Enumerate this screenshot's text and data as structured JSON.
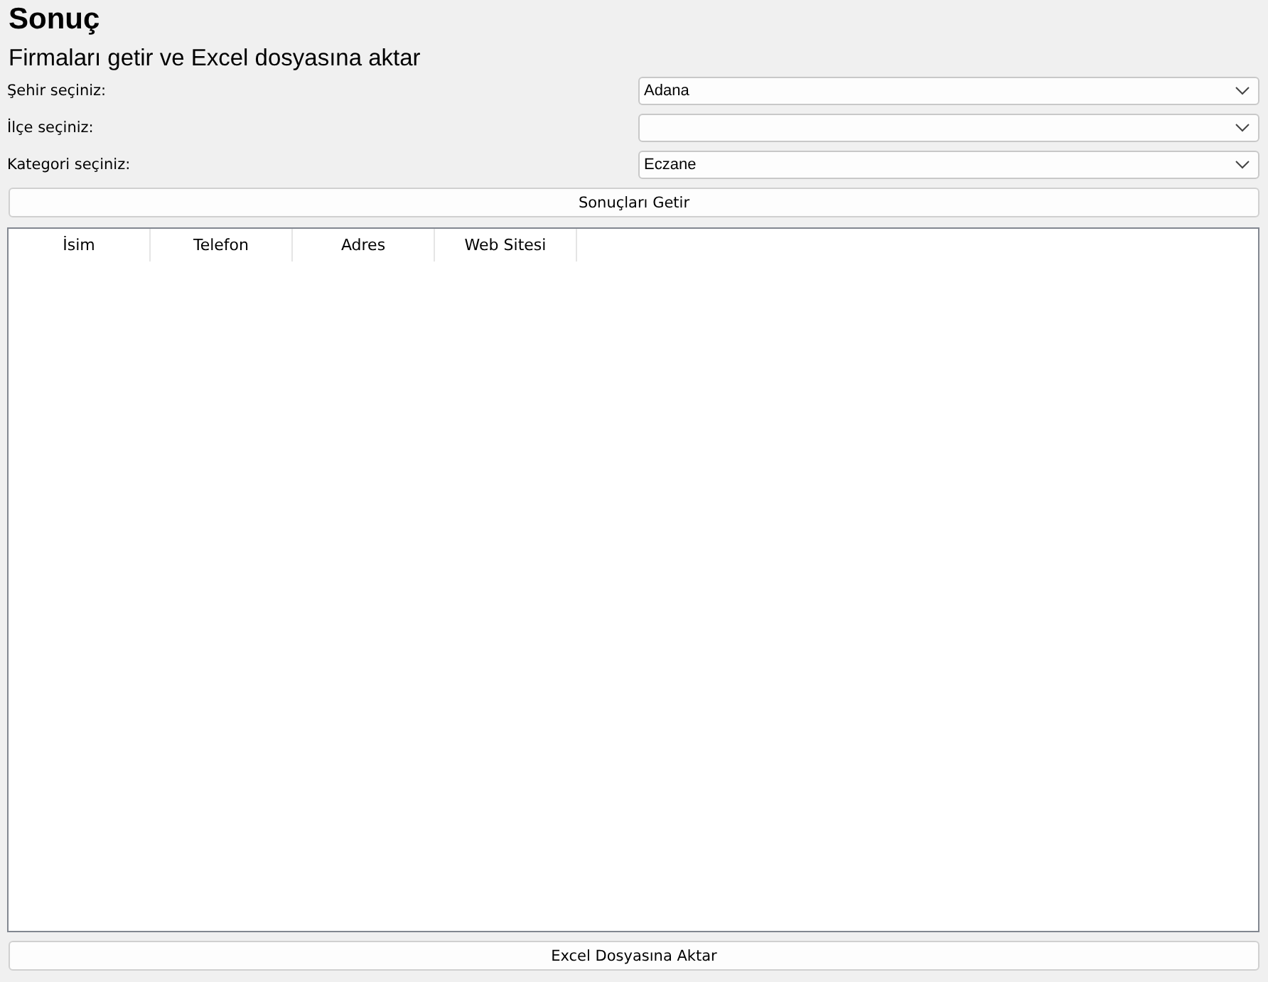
{
  "title": "Sonuç",
  "subtitle": "Firmaları getir ve Excel dosyasına aktar",
  "fields": [
    {
      "label": "Şehir seçiniz:",
      "value": "Adana"
    },
    {
      "label": "İlçe seçiniz:"
    },
    {
      "label": "Kategori seçiniz:",
      "value": "Eczane"
    }
  ],
  "fetch_button": "Sonuçları Getir",
  "table": {
    "columns": [
      "İsim",
      "Telefon",
      "Adres",
      "Web Sitesi"
    ]
  },
  "export_button": "Excel Dosyasına Aktar"
}
